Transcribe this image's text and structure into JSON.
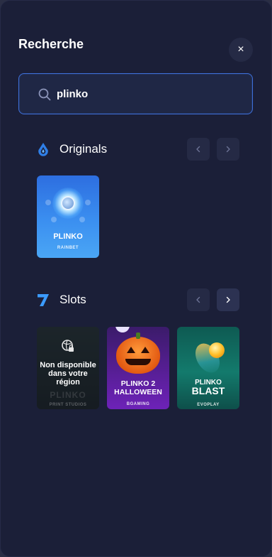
{
  "header": {
    "title": "Recherche",
    "close_label": "×"
  },
  "search": {
    "value": "plinko",
    "placeholder": ""
  },
  "sections": [
    {
      "title": "Originals",
      "icon": "droplet-icon",
      "games": [
        {
          "name": "PLINKO",
          "provider": "RAINBET"
        }
      ]
    },
    {
      "title": "Slots",
      "icon": "seven-icon",
      "games": [
        {
          "name": "PLINKO",
          "provider": "PRINT STUDIOS",
          "unavailable_text": "Non disponible dans votre région"
        },
        {
          "name": "PLINKO 2 HALLOWEEN",
          "provider": "BGAMING"
        },
        {
          "name": "PLINKO",
          "name2": "BLAST",
          "provider": "EVOPLAY"
        }
      ]
    }
  ],
  "colors": {
    "accent": "#3e6fd8",
    "panel": "#1b1f38",
    "button": "#252a45",
    "icon_blue": "#4da3ff"
  }
}
